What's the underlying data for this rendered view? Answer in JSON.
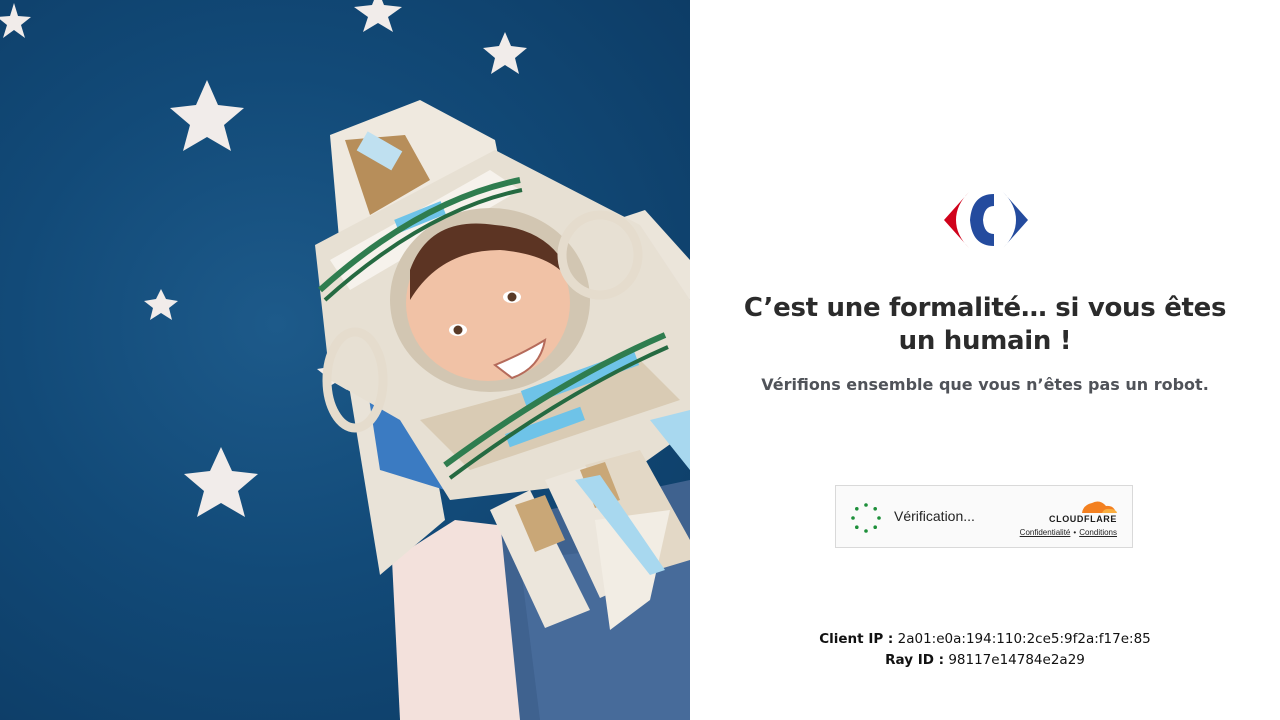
{
  "brand": {
    "logo_icon": "carrefour-logo-icon",
    "colors": {
      "red": "#d0021b",
      "blue": "#244b9e"
    }
  },
  "heading": {
    "title": "C’est une formalité… si vous êtes un humain !",
    "subtitle": "Vérifions ensemble que vous n’êtes pas un robot."
  },
  "challenge": {
    "status_label": "Vérification...",
    "provider": "CLOUDFLARE",
    "privacy_link": "Confidentialité",
    "separator": "•",
    "terms_link": "Conditions",
    "spinner_icon": "loading-spinner-icon",
    "provider_icon": "cloudflare-cloud-icon",
    "accent": "#f38020"
  },
  "info": {
    "client_ip_label": "Client IP :",
    "client_ip_value": "2a01:e0a:194:110:2ce5:9f2a:f17e:85",
    "ray_id_label": "Ray ID :",
    "ray_id_value": "98117e14784e2a29"
  }
}
